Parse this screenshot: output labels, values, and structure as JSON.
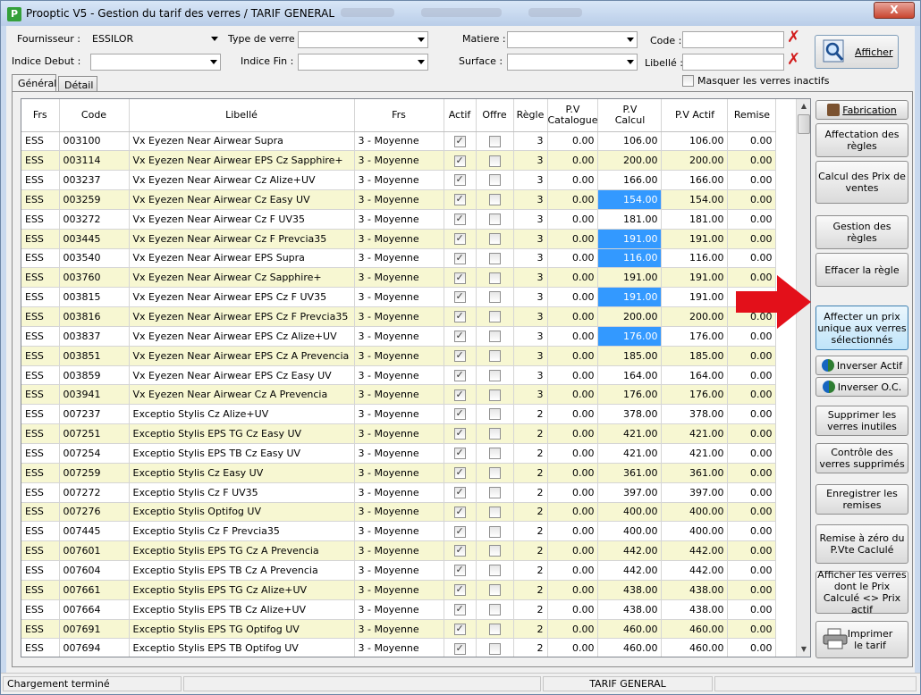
{
  "window": {
    "title": "Prooptic V5 - Gestion du tarif des verres / TARIF GENERAL",
    "app_icon": "P",
    "close_glyph": "X"
  },
  "filters": {
    "fournisseur_label": "Fournisseur :",
    "fournisseur_value": "ESSILOR",
    "type_verre_label": "Type de verre :",
    "matiere_label": "Matiere :",
    "code_label": "Code :",
    "indice_debut_label": "Indice Debut :",
    "indice_fin_label": "Indice Fin :",
    "surface_label": "Surface :",
    "libelle_label": "Libellé :",
    "masquer_label": "Masquer les verres inactifs",
    "afficher_label": "Afficher",
    "clear_glyph": "✗"
  },
  "tabs": [
    "Général",
    "Détail"
  ],
  "grid": {
    "columns": [
      "Frs",
      "Code",
      "Libellé",
      "Frs",
      "Actif",
      "Offre",
      "Règle",
      "P.V\nCatalogue",
      "P.V\nCalcul",
      "P.V Actif",
      "Remise"
    ],
    "rows": [
      [
        "ESS",
        "003100",
        "Vx Eyezen Near Airwear Supra",
        "3 - Moyenne",
        true,
        false,
        "3",
        "0.00",
        "106.00",
        "106.00",
        "0.00",
        false
      ],
      [
        "ESS",
        "003114",
        "Vx Eyezen Near Airwear EPS Cz Sapphire+",
        "3 - Moyenne",
        true,
        false,
        "3",
        "0.00",
        "200.00",
        "200.00",
        "0.00",
        false
      ],
      [
        "ESS",
        "003237",
        "Vx Eyezen Near Airwear Cz Alize+UV",
        "3 - Moyenne",
        true,
        false,
        "3",
        "0.00",
        "166.00",
        "166.00",
        "0.00",
        false
      ],
      [
        "ESS",
        "003259",
        "Vx Eyezen Near Airwear Cz Easy UV",
        "3 - Moyenne",
        true,
        false,
        "3",
        "0.00",
        "154.00",
        "154.00",
        "0.00",
        true
      ],
      [
        "ESS",
        "003272",
        "Vx Eyezen Near Airwear Cz F UV35",
        "3 - Moyenne",
        true,
        false,
        "3",
        "0.00",
        "181.00",
        "181.00",
        "0.00",
        false
      ],
      [
        "ESS",
        "003445",
        "Vx Eyezen Near Airwear Cz F Prevcia35",
        "3 - Moyenne",
        true,
        false,
        "3",
        "0.00",
        "191.00",
        "191.00",
        "0.00",
        true
      ],
      [
        "ESS",
        "003540",
        "Vx Eyezen Near Airwear EPS Supra",
        "3 - Moyenne",
        true,
        false,
        "3",
        "0.00",
        "116.00",
        "116.00",
        "0.00",
        true
      ],
      [
        "ESS",
        "003760",
        "Vx Eyezen Near Airwear Cz Sapphire+",
        "3 - Moyenne",
        true,
        false,
        "3",
        "0.00",
        "191.00",
        "191.00",
        "0.00",
        false
      ],
      [
        "ESS",
        "003815",
        "Vx Eyezen Near Airwear EPS Cz F UV35",
        "3 - Moyenne",
        true,
        false,
        "3",
        "0.00",
        "191.00",
        "191.00",
        "0.00",
        true
      ],
      [
        "ESS",
        "003816",
        "Vx Eyezen Near Airwear EPS Cz F Prevcia35",
        "3 - Moyenne",
        true,
        false,
        "3",
        "0.00",
        "200.00",
        "200.00",
        "0.00",
        false
      ],
      [
        "ESS",
        "003837",
        "Vx Eyezen Near Airwear EPS Cz Alize+UV",
        "3 - Moyenne",
        true,
        false,
        "3",
        "0.00",
        "176.00",
        "176.00",
        "0.00",
        true
      ],
      [
        "ESS",
        "003851",
        "Vx Eyezen Near Airwear EPS Cz A Prevencia",
        "3 - Moyenne",
        true,
        false,
        "3",
        "0.00",
        "185.00",
        "185.00",
        "0.00",
        false
      ],
      [
        "ESS",
        "003859",
        "Vx Eyezen Near Airwear EPS Cz Easy UV",
        "3 - Moyenne",
        true,
        false,
        "3",
        "0.00",
        "164.00",
        "164.00",
        "0.00",
        false
      ],
      [
        "ESS",
        "003941",
        "Vx Eyezen Near Airwear Cz A Prevencia",
        "3 - Moyenne",
        true,
        false,
        "3",
        "0.00",
        "176.00",
        "176.00",
        "0.00",
        false
      ],
      [
        "ESS",
        "007237",
        "Exceptio Stylis Cz Alize+UV",
        "3 - Moyenne",
        true,
        false,
        "2",
        "0.00",
        "378.00",
        "378.00",
        "0.00",
        false
      ],
      [
        "ESS",
        "007251",
        "Exceptio Stylis EPS TG Cz Easy UV",
        "3 - Moyenne",
        true,
        false,
        "2",
        "0.00",
        "421.00",
        "421.00",
        "0.00",
        false
      ],
      [
        "ESS",
        "007254",
        "Exceptio Stylis EPS TB Cz Easy UV",
        "3 - Moyenne",
        true,
        false,
        "2",
        "0.00",
        "421.00",
        "421.00",
        "0.00",
        false
      ],
      [
        "ESS",
        "007259",
        "Exceptio Stylis Cz Easy UV",
        "3 - Moyenne",
        true,
        false,
        "2",
        "0.00",
        "361.00",
        "361.00",
        "0.00",
        false
      ],
      [
        "ESS",
        "007272",
        "Exceptio Stylis Cz F UV35",
        "3 - Moyenne",
        true,
        false,
        "2",
        "0.00",
        "397.00",
        "397.00",
        "0.00",
        false
      ],
      [
        "ESS",
        "007276",
        "Exceptio Stylis Optifog UV",
        "3 - Moyenne",
        true,
        false,
        "2",
        "0.00",
        "400.00",
        "400.00",
        "0.00",
        false
      ],
      [
        "ESS",
        "007445",
        "Exceptio Stylis Cz F Prevcia35",
        "3 - Moyenne",
        true,
        false,
        "2",
        "0.00",
        "400.00",
        "400.00",
        "0.00",
        false
      ],
      [
        "ESS",
        "007601",
        "Exceptio Stylis EPS TG Cz A Prevencia",
        "3 - Moyenne",
        true,
        false,
        "2",
        "0.00",
        "442.00",
        "442.00",
        "0.00",
        false
      ],
      [
        "ESS",
        "007604",
        "Exceptio Stylis EPS TB Cz A Prevencia",
        "3 - Moyenne",
        true,
        false,
        "2",
        "0.00",
        "442.00",
        "442.00",
        "0.00",
        false
      ],
      [
        "ESS",
        "007661",
        "Exceptio Stylis EPS TG Cz Alize+UV",
        "3 - Moyenne",
        true,
        false,
        "2",
        "0.00",
        "438.00",
        "438.00",
        "0.00",
        false
      ],
      [
        "ESS",
        "007664",
        "Exceptio Stylis EPS TB Cz Alize+UV",
        "3 - Moyenne",
        true,
        false,
        "2",
        "0.00",
        "438.00",
        "438.00",
        "0.00",
        false
      ],
      [
        "ESS",
        "007691",
        "Exceptio Stylis EPS TG Optifog UV",
        "3 - Moyenne",
        true,
        false,
        "2",
        "0.00",
        "460.00",
        "460.00",
        "0.00",
        false
      ],
      [
        "ESS",
        "007694",
        "Exceptio Stylis EPS TB Optifog UV",
        "3 - Moyenne",
        true,
        false,
        "2",
        "0.00",
        "460.00",
        "460.00",
        "0.00",
        false
      ]
    ]
  },
  "actions": {
    "fabrication": "Fabrication",
    "affectation": "Affectation des règles",
    "calcul": "Calcul des Prix de ventes",
    "gestion": "Gestion des règles",
    "effacer": "Effacer la règle",
    "affecter_prix": "Affecter un prix unique aux verres sélectionnés",
    "inverser_actif": "Inverser Actif",
    "inverser_oc": "Inverser O.C.",
    "supprimer": "Supprimer les verres inutiles",
    "controle": "Contrôle des verres supprimés",
    "enregistrer": "Enregistrer les remises",
    "remise_zero": "Remise à zéro du P.Vte Caclulé",
    "afficher_verres": "Afficher les verres dont le Prix Calculé <> Prix actif",
    "imprimer": "Imprimer le tarif"
  },
  "colors": {
    "highlight": "#3399ff",
    "alt_row": "#f7f7d2",
    "arrow": "#e3101a"
  },
  "status": {
    "left": "Chargement terminé",
    "right": "TARIF GENERAL"
  }
}
